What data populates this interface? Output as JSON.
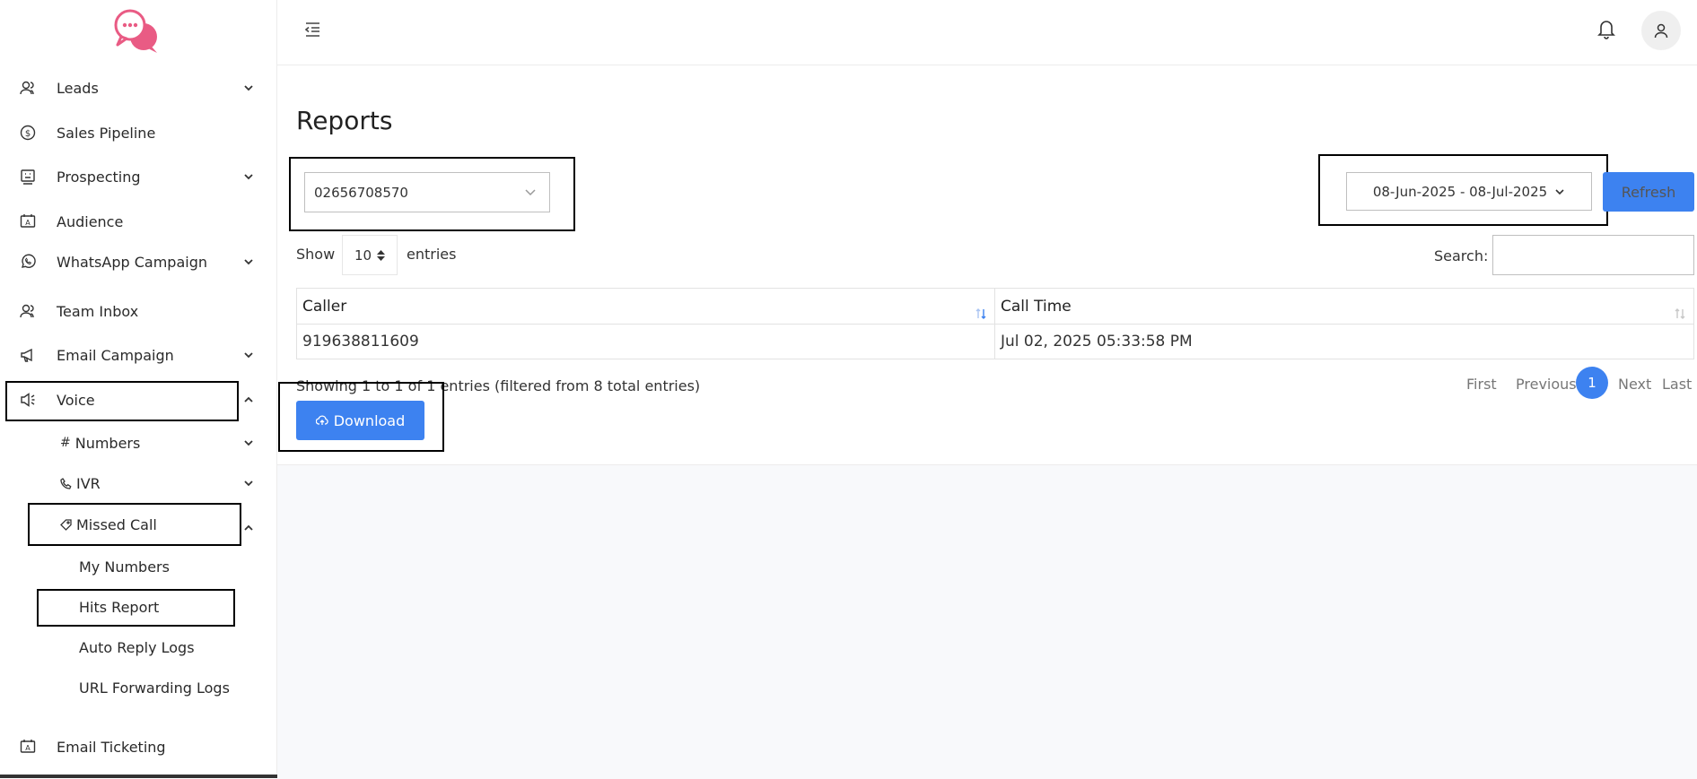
{
  "sidebar": {
    "items": {
      "leads": "Leads",
      "sales_pipeline": "Sales Pipeline",
      "prospecting": "Prospecting",
      "audience": "Audience",
      "whatsapp_campaign": "WhatsApp Campaign",
      "team_inbox": "Team Inbox",
      "email_campaign": "Email Campaign",
      "voice": "Voice",
      "email_ticketing": "Email Ticketing"
    },
    "voice_sub": {
      "numbers": "Numbers",
      "ivr": "IVR",
      "missed_call": "Missed Call"
    },
    "missed_call_sub": {
      "my_numbers": "My Numbers",
      "hits_report": "Hits Report",
      "auto_reply_logs": "Auto Reply Logs",
      "url_forwarding_logs": "URL Forwarding Logs"
    }
  },
  "page": {
    "title": "Reports",
    "number_select_value": "02656708570",
    "date_range": "08-Jun-2025 - 08-Jul-2025",
    "refresh_label": "Refresh",
    "show_label": "Show",
    "entries_value": "10",
    "entries_label": "entries",
    "search_label": "Search:",
    "search_value": ""
  },
  "table": {
    "columns": [
      "Caller",
      "Call Time"
    ],
    "rows": [
      [
        "919638811609",
        "Jul 02, 2025 05:33:58 PM"
      ]
    ],
    "info": "Showing 1 to 1 of 1 entries (filtered from 8 total entries)"
  },
  "download_label": "Download",
  "pagination": {
    "first": "First",
    "previous": "Previous",
    "current": "1",
    "next": "Next",
    "last": "Last"
  },
  "colors": {
    "primary": "#3d82f0",
    "logo": "#e95b84"
  },
  "icons": [
    "chat-bubbles-logo",
    "user-icon",
    "dollar-icon",
    "prospecting-icon",
    "audience-icon",
    "whatsapp-icon",
    "team-icon",
    "megaphone-icon",
    "speaker-icon",
    "hash-icon",
    "phone-icon",
    "tag-icon",
    "bell-icon",
    "menu-toggle-icon",
    "cloud-upload-icon"
  ]
}
